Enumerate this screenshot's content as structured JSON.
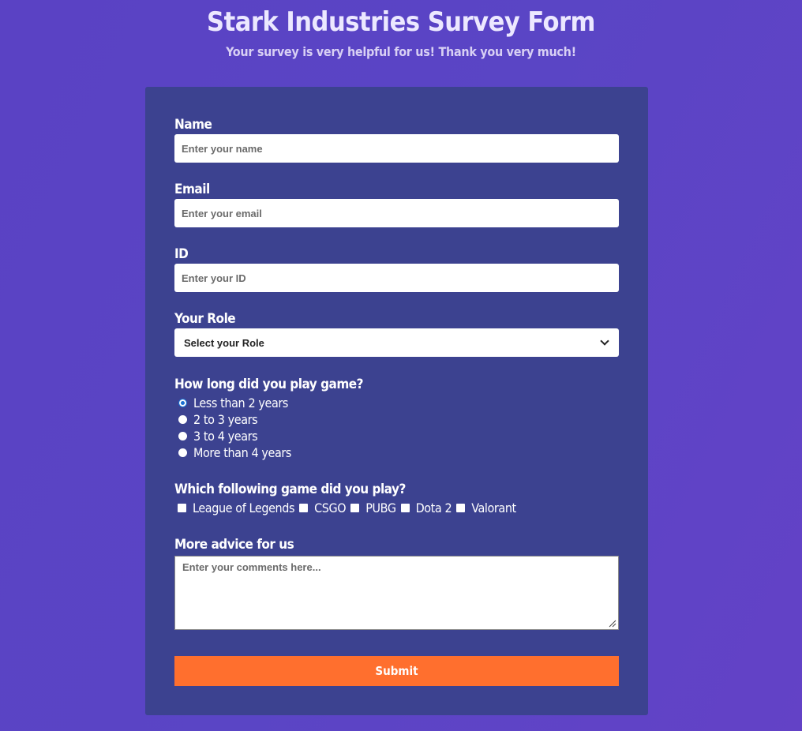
{
  "header": {
    "title": "Stark Industries Survey Form",
    "subtitle": "Your survey is very helpful for us! Thank you very much!"
  },
  "form": {
    "name": {
      "label": "Name",
      "placeholder": "Enter your name"
    },
    "email": {
      "label": "Email",
      "placeholder": "Enter your email"
    },
    "id": {
      "label": "ID",
      "placeholder": "Enter your ID"
    },
    "role": {
      "label": "Your Role",
      "selected": "Select your Role",
      "icon": "chevron-down-icon"
    },
    "duration": {
      "question": "How long did you play game?",
      "options": [
        "Less than 2 years",
        "2 to 3 years",
        "3 to 4 years",
        "More than 4 years"
      ],
      "selected_index": 0
    },
    "games": {
      "question": "Which following game did you play?",
      "options": [
        "League of Legends",
        "CSGO",
        "PUBG",
        "Dota 2",
        "Valorant"
      ]
    },
    "advice": {
      "label": "More advice for us",
      "placeholder": "Enter your comments here..."
    },
    "submit_label": "Submit"
  },
  "colors": {
    "background": "#5a44c5",
    "card": "#3c4290",
    "submit": "#ff6f2e",
    "radio_selected": "#1a6fd1"
  }
}
